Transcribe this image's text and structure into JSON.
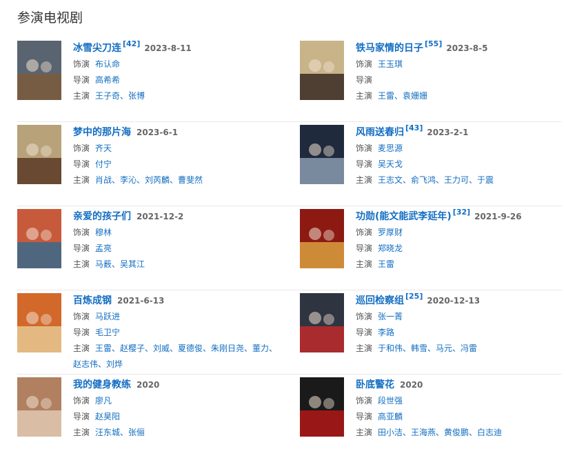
{
  "section_title": "参演电视剧",
  "rows": [
    [
      {
        "title": "冰雪尖刀连",
        "ref": "[42]",
        "date": "2023-8-11",
        "role_label": "饰演",
        "role": "布认命",
        "director_label": "导演",
        "director": "高希希",
        "cast_label": "主演",
        "cast": "王子奇、张博"
      },
      {
        "title": "铁马家情的日子",
        "ref": "[55]",
        "date": "2023-8-5",
        "role_label": "饰演",
        "role": "王玉琪",
        "director_label": "导演",
        "director": "",
        "cast_label": "主演",
        "cast": "王雷、袁姗姗"
      }
    ],
    [
      {
        "title": "梦中的那片海",
        "ref": "",
        "date": "2023-6-1",
        "role_label": "饰演",
        "role": "齐天",
        "director_label": "导演",
        "director": "付宁",
        "cast_label": "主演",
        "cast": "肖战、李沁、刘芮麟、曹斐然"
      },
      {
        "title": "风雨送春归",
        "ref": "[43]",
        "date": "2023-2-1",
        "role_label": "饰演",
        "role": "麦思源",
        "director_label": "导演",
        "director": "吴天戈",
        "cast_label": "主演",
        "cast": "王志文、俞飞鸿、王力可、于震"
      }
    ],
    [
      {
        "title": "亲爱的孩子们",
        "ref": "",
        "date": "2021-12-2",
        "role_label": "饰演",
        "role": "穆林",
        "director_label": "导演",
        "director": "孟亮",
        "cast_label": "主演",
        "cast": "马薮、吴其江"
      },
      {
        "title": "功勋(能文能武李延年)",
        "ref": "[32]",
        "date": "2021-9-26",
        "role_label": "饰演",
        "role": "罗厚财",
        "director_label": "导演",
        "director": "郑晓龙",
        "cast_label": "主演",
        "cast": "王雷"
      }
    ],
    [
      {
        "title": "百炼成钢",
        "ref": "",
        "date": "2021-6-13",
        "role_label": "饰演",
        "role": "马跃进",
        "director_label": "导演",
        "director": "毛卫宁",
        "cast_label": "主演",
        "cast": "王雷、赵樱子、刘威、夏德俊、朱刚日尧、董力、赵志伟、刘烨"
      },
      {
        "title": "巡回检察组",
        "ref": "[25]",
        "date": "2020-12-13",
        "role_label": "饰演",
        "role": "张一菁",
        "director_label": "导演",
        "director": "李路",
        "cast_label": "主演",
        "cast": "于和伟、韩雪、马元、冯雷"
      }
    ],
    [
      {
        "title": "我的健身教练",
        "ref": "",
        "date": "2020",
        "role_label": "饰演",
        "role": "廖凡",
        "director_label": "导演",
        "director": "赵昊阳",
        "cast_label": "主演",
        "cast": "汪东城、张俪"
      },
      {
        "title": "卧底警花",
        "ref": "",
        "date": "2020",
        "role_label": "饰演",
        "role": "段世强",
        "director_label": "导演",
        "director": "高亚麟",
        "cast_label": "主演",
        "cast": "田小洁、王海燕、黄俊鹏、白志迪"
      }
    ]
  ],
  "posters": [
    [
      "#5a6470",
      "#7d5a3c"
    ],
    [
      "#c9b48a",
      "#3a2a22"
    ],
    [
      "#b7a27a",
      "#5c3a24"
    ],
    [
      "#1f2a3c",
      "#8a9bb0"
    ],
    [
      "#c85a3c",
      "#3a6a8a"
    ],
    [
      "#8c1a12",
      "#d8a040"
    ],
    [
      "#d2692a",
      "#e8c890"
    ],
    [
      "#2e3440",
      "#c02a2a"
    ],
    [
      "#b08060",
      "#e0c8b0"
    ],
    [
      "#1a1a1a",
      "#b01818"
    ]
  ]
}
